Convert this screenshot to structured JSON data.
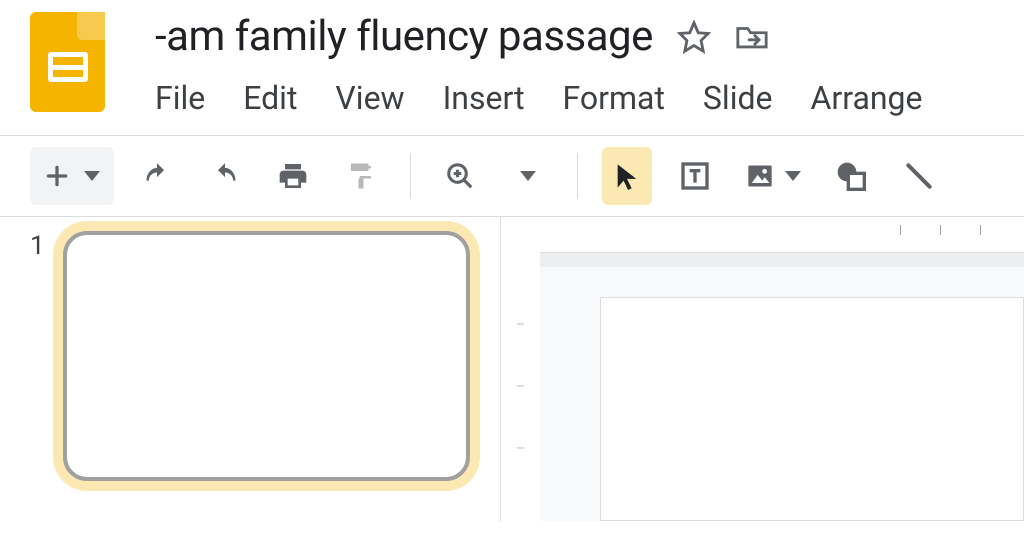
{
  "document": {
    "title": "-am family fluency passage"
  },
  "menus": {
    "file": "File",
    "edit": "Edit",
    "view": "View",
    "insert": "Insert",
    "format": "Format",
    "slide": "Slide",
    "arrange": "Arrange"
  },
  "slides": {
    "first_number": "1"
  },
  "icons": {
    "star": "star-outline",
    "move": "move-to-folder",
    "newslide": "plus",
    "undo": "undo",
    "redo": "redo",
    "print": "printer",
    "paint": "paint-format",
    "zoom": "zoom",
    "select": "cursor",
    "textbox": "text-box",
    "image": "image",
    "shape": "shape-circle-square",
    "line": "line"
  }
}
